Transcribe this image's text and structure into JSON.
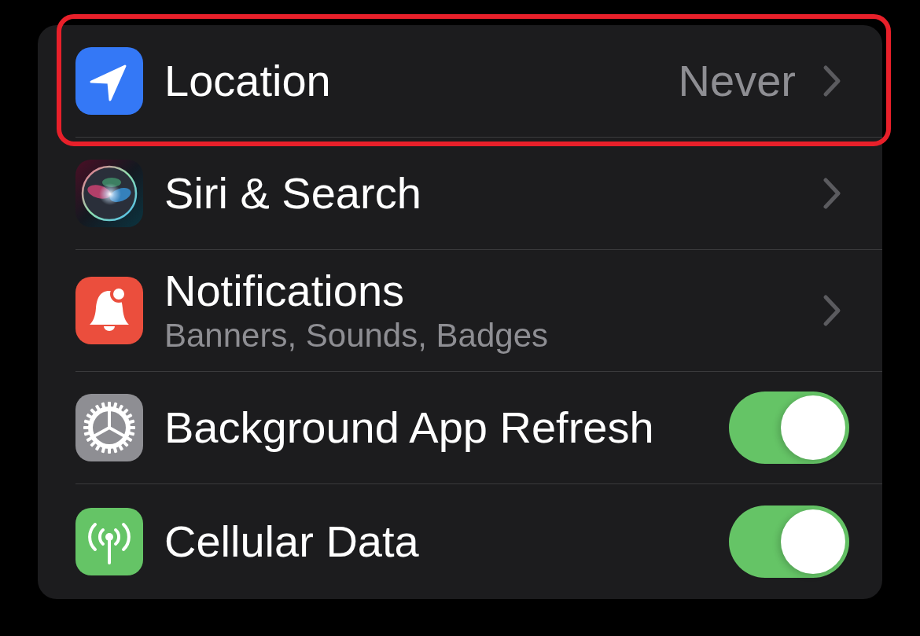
{
  "settings_list": {
    "rows": [
      {
        "kind": "link",
        "label": "Location",
        "value": "Never",
        "highlighted": true
      },
      {
        "kind": "link",
        "label": "Siri & Search",
        "highlighted": false
      },
      {
        "kind": "link",
        "label": "Notifications",
        "subtitle": "Banners, Sounds, Badges",
        "highlighted": false
      },
      {
        "kind": "toggle",
        "label": "Background App Refresh",
        "on": true,
        "highlighted": false
      },
      {
        "kind": "toggle",
        "label": "Cellular Data",
        "on": true,
        "highlighted": false
      }
    ]
  }
}
